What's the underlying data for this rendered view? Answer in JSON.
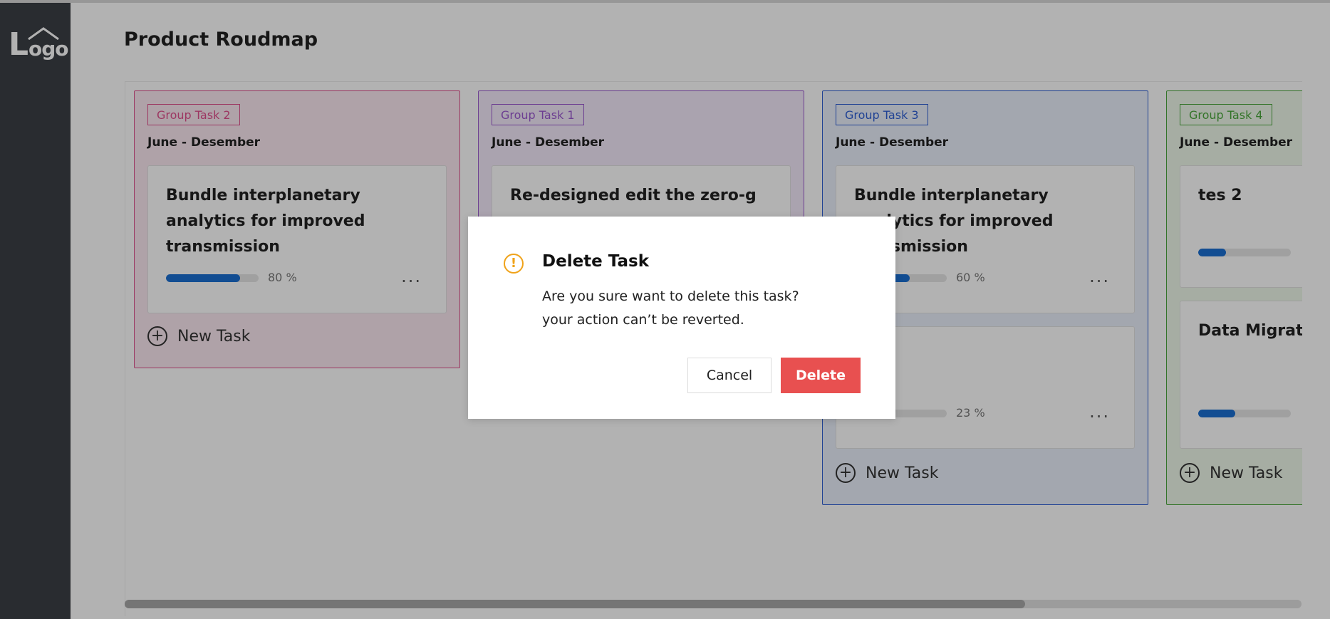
{
  "logo": {
    "first": "L",
    "rest": "ogo"
  },
  "page": {
    "title": "Product Roudmap"
  },
  "columns": [
    {
      "tag": "Group Task 2",
      "date": "June - Desember",
      "color": "#e0508d",
      "bg": "#fbe9f1",
      "cards": [
        {
          "title": "Bundle interplanetary analytics for improved transmission",
          "percent_label": "80 %",
          "progress": 0.8,
          "menu": "..."
        }
      ],
      "new_task_label": "New Task"
    },
    {
      "tag": "Group Task 1",
      "date": "June - Desember",
      "color": "#9b59d0",
      "bg": "#f4eafb",
      "cards": [
        {
          "title": "Re-designed edit the zero-g",
          "percent_label": "",
          "progress": 0,
          "menu": ""
        }
      ],
      "new_task_label": ""
    },
    {
      "tag": "Group Task 3",
      "date": "June - Desember",
      "color": "#2f5fd4",
      "bg": "#eaf0fb",
      "cards": [
        {
          "title": "Bundle interplanetary analytics for improved transmission",
          "percent_label": "60 %",
          "progress": 0.6,
          "menu": "..."
        },
        {
          "title": "",
          "percent_label": "23 %",
          "progress": 0.23,
          "menu": "..."
        }
      ],
      "new_task_label": "New Task"
    },
    {
      "tag": "Group Task 4",
      "date": "June - Desember",
      "color": "#4aa73b",
      "bg": "#eef8ea",
      "cards": [
        {
          "title": "tes 2",
          "percent_label": "",
          "progress": 0.3,
          "menu": ""
        },
        {
          "title": "Data Migration Culture End (",
          "percent_label": "",
          "progress": 0.4,
          "menu": ""
        }
      ],
      "new_task_label": "New Task"
    }
  ],
  "scrollbar": {
    "thumb_fraction": 0.765
  },
  "modal": {
    "title": "Delete Task",
    "message_line1": "Are you sure want to delete this task?",
    "message_line2": "your action can’t be reverted.",
    "cancel_label": "Cancel",
    "delete_label": "Delete",
    "icon": "warning-icon",
    "icon_glyph": "!"
  },
  "colors": {
    "sidebar": "#3b4046",
    "progress": "#1b6fd1",
    "delete": "#e85050",
    "warning": "#f0a31a"
  }
}
